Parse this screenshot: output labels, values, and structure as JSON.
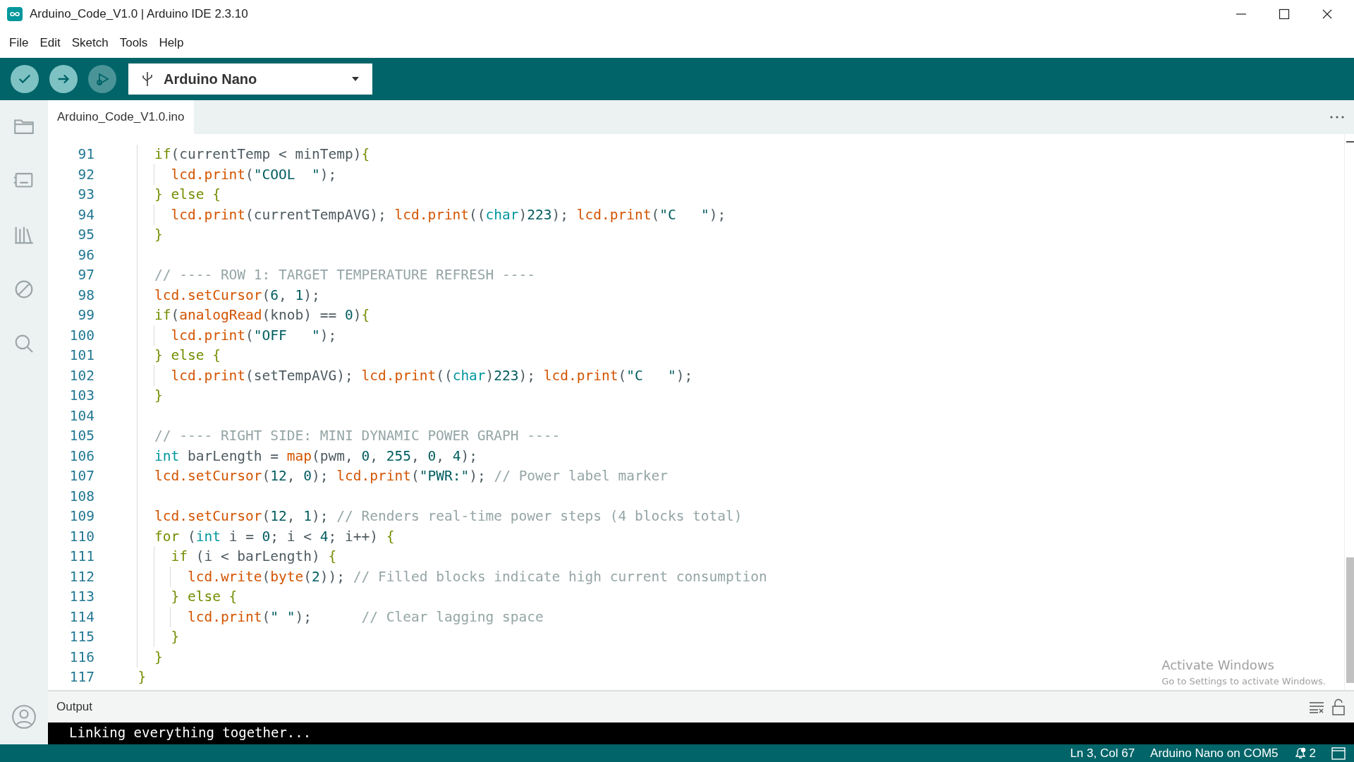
{
  "window": {
    "title": "Arduino_Code_V1.0 | Arduino IDE 2.3.10"
  },
  "menu": [
    "File",
    "Edit",
    "Sketch",
    "Tools",
    "Help"
  ],
  "toolbar": {
    "buttons": [
      {
        "kind": "verify",
        "disabled": false
      },
      {
        "kind": "upload",
        "disabled": false
      },
      {
        "kind": "debug",
        "disabled": true
      }
    ],
    "board": "Arduino Nano"
  },
  "sidebar": [
    {
      "kind": "folder",
      "selected": false
    },
    {
      "kind": "board",
      "selected": false
    },
    {
      "kind": "library",
      "selected": false
    },
    {
      "kind": "debug",
      "selected": false
    },
    {
      "kind": "search",
      "selected": false
    }
  ],
  "tabs": [
    {
      "label": "Arduino_Code_V1.0.ino",
      "selected": true
    }
  ],
  "editor": {
    "lines": [
      {
        "number": "91",
        "tokens": [
          {
            "kind": "kw",
            "text": "    if"
          },
          {
            "kind": "p",
            "text": "(currentTemp < minTemp)"
          },
          {
            "kind": "kw",
            "text": "{"
          }
        ]
      },
      {
        "number": "92",
        "tokens": [
          {
            "kind": "fn",
            "text": "      lcd.print"
          },
          {
            "kind": "p",
            "text": "("
          },
          {
            "kind": "str",
            "text": "\"COOL  \""
          },
          {
            "kind": "p",
            "text": ");"
          }
        ]
      },
      {
        "number": "93",
        "tokens": [
          {
            "kind": "kw",
            "text": "    } else {"
          }
        ]
      },
      {
        "number": "94",
        "tokens": [
          {
            "kind": "fn",
            "text": "      lcd.print"
          },
          {
            "kind": "p",
            "text": "(currentTempAVG); "
          },
          {
            "kind": "fn",
            "text": "lcd.print"
          },
          {
            "kind": "p",
            "text": "(("
          },
          {
            "kind": "type",
            "text": "char"
          },
          {
            "kind": "p",
            "text": ")"
          },
          {
            "kind": "num",
            "text": "223"
          },
          {
            "kind": "p",
            "text": "); "
          },
          {
            "kind": "fn",
            "text": "lcd.print"
          },
          {
            "kind": "p",
            "text": "("
          },
          {
            "kind": "str",
            "text": "\"C   \""
          },
          {
            "kind": "p",
            "text": ");"
          }
        ]
      },
      {
        "number": "95",
        "tokens": [
          {
            "kind": "kw",
            "text": "    }"
          }
        ]
      },
      {
        "number": "96"
      },
      {
        "number": "97",
        "tokens": [
          {
            "kind": "cm",
            "text": "    // ---- ROW 1: TARGET TEMPERATURE REFRESH ----"
          }
        ]
      },
      {
        "number": "98",
        "tokens": [
          {
            "kind": "fn",
            "text": "    lcd.setCursor"
          },
          {
            "kind": "p",
            "text": "("
          },
          {
            "kind": "num",
            "text": "6"
          },
          {
            "kind": "p",
            "text": ", "
          },
          {
            "kind": "num",
            "text": "1"
          },
          {
            "kind": "p",
            "text": ");"
          }
        ]
      },
      {
        "number": "99",
        "tokens": [
          {
            "kind": "kw",
            "text": "    if"
          },
          {
            "kind": "p",
            "text": "("
          },
          {
            "kind": "fn",
            "text": "analogRead"
          },
          {
            "kind": "p",
            "text": "(knob) == "
          },
          {
            "kind": "num",
            "text": "0"
          },
          {
            "kind": "p",
            "text": ")"
          },
          {
            "kind": "kw",
            "text": "{"
          }
        ]
      },
      {
        "number": "100",
        "tokens": [
          {
            "kind": "fn",
            "text": "      lcd.print"
          },
          {
            "kind": "p",
            "text": "("
          },
          {
            "kind": "str",
            "text": "\"OFF   \""
          },
          {
            "kind": "p",
            "text": ");"
          }
        ]
      },
      {
        "number": "101",
        "tokens": [
          {
            "kind": "kw",
            "text": "    } else {"
          }
        ]
      },
      {
        "number": "102",
        "tokens": [
          {
            "kind": "fn",
            "text": "      lcd.print"
          },
          {
            "kind": "p",
            "text": "(setTempAVG); "
          },
          {
            "kind": "fn",
            "text": "lcd.print"
          },
          {
            "kind": "p",
            "text": "(("
          },
          {
            "kind": "type",
            "text": "char"
          },
          {
            "kind": "p",
            "text": ")"
          },
          {
            "kind": "num",
            "text": "223"
          },
          {
            "kind": "p",
            "text": "); "
          },
          {
            "kind": "fn",
            "text": "lcd.print"
          },
          {
            "kind": "p",
            "text": "("
          },
          {
            "kind": "str",
            "text": "\"C   \""
          },
          {
            "kind": "p",
            "text": ");"
          }
        ]
      },
      {
        "number": "103",
        "tokens": [
          {
            "kind": "kw",
            "text": "    }"
          }
        ]
      },
      {
        "number": "104"
      },
      {
        "number": "105",
        "tokens": [
          {
            "kind": "cm",
            "text": "    // ---- RIGHT SIDE: MINI DYNAMIC POWER GRAPH ----"
          }
        ]
      },
      {
        "number": "106",
        "tokens": [
          {
            "kind": "type",
            "text": "    int"
          },
          {
            "kind": "p",
            "text": " barLength = "
          },
          {
            "kind": "fn",
            "text": "map"
          },
          {
            "kind": "p",
            "text": "(pwm, "
          },
          {
            "kind": "num",
            "text": "0"
          },
          {
            "kind": "p",
            "text": ", "
          },
          {
            "kind": "num",
            "text": "255"
          },
          {
            "kind": "p",
            "text": ", "
          },
          {
            "kind": "num",
            "text": "0"
          },
          {
            "kind": "p",
            "text": ", "
          },
          {
            "kind": "num",
            "text": "4"
          },
          {
            "kind": "p",
            "text": ");"
          }
        ]
      },
      {
        "number": "107",
        "tokens": [
          {
            "kind": "fn",
            "text": "    lcd.setCursor"
          },
          {
            "kind": "p",
            "text": "("
          },
          {
            "kind": "num",
            "text": "12"
          },
          {
            "kind": "p",
            "text": ", "
          },
          {
            "kind": "num",
            "text": "0"
          },
          {
            "kind": "p",
            "text": "); "
          },
          {
            "kind": "fn",
            "text": "lcd.print"
          },
          {
            "kind": "p",
            "text": "("
          },
          {
            "kind": "str",
            "text": "\"PWR:\""
          },
          {
            "kind": "p",
            "text": "); "
          },
          {
            "kind": "cm",
            "text": "// Power label marker"
          }
        ]
      },
      {
        "number": "108"
      },
      {
        "number": "109",
        "tokens": [
          {
            "kind": "fn",
            "text": "    lcd.setCursor"
          },
          {
            "kind": "p",
            "text": "("
          },
          {
            "kind": "num",
            "text": "12"
          },
          {
            "kind": "p",
            "text": ", "
          },
          {
            "kind": "num",
            "text": "1"
          },
          {
            "kind": "p",
            "text": "); "
          },
          {
            "kind": "cm",
            "text": "// Renders real-time power steps (4 blocks total)"
          }
        ]
      },
      {
        "number": "110",
        "tokens": [
          {
            "kind": "kw",
            "text": "    for"
          },
          {
            "kind": "p",
            "text": " ("
          },
          {
            "kind": "type",
            "text": "int"
          },
          {
            "kind": "p",
            "text": " i = "
          },
          {
            "kind": "num",
            "text": "0"
          },
          {
            "kind": "p",
            "text": "; i < "
          },
          {
            "kind": "num",
            "text": "4"
          },
          {
            "kind": "p",
            "text": "; i++) "
          },
          {
            "kind": "kw",
            "text": "{"
          }
        ]
      },
      {
        "number": "111",
        "tokens": [
          {
            "kind": "kw",
            "text": "      if"
          },
          {
            "kind": "p",
            "text": " (i < barLength) "
          },
          {
            "kind": "kw",
            "text": "{"
          }
        ]
      },
      {
        "number": "112",
        "tokens": [
          {
            "kind": "fn",
            "text": "        lcd.write"
          },
          {
            "kind": "p",
            "text": "("
          },
          {
            "kind": "fn",
            "text": "byte"
          },
          {
            "kind": "p",
            "text": "("
          },
          {
            "kind": "num",
            "text": "2"
          },
          {
            "kind": "p",
            "text": ")); "
          },
          {
            "kind": "cm",
            "text": "// Filled blocks indicate high current consumption"
          }
        ]
      },
      {
        "number": "113",
        "tokens": [
          {
            "kind": "kw",
            "text": "      } else {"
          }
        ]
      },
      {
        "number": "114",
        "tokens": [
          {
            "kind": "fn",
            "text": "        lcd.print"
          },
          {
            "kind": "p",
            "text": "("
          },
          {
            "kind": "str",
            "text": "\" \""
          },
          {
            "kind": "p",
            "text": ");      "
          },
          {
            "kind": "cm",
            "text": "// Clear lagging space"
          }
        ]
      },
      {
        "number": "115",
        "tokens": [
          {
            "kind": "kw",
            "text": "      }"
          }
        ]
      },
      {
        "number": "116",
        "tokens": [
          {
            "kind": "kw",
            "text": "    }"
          }
        ]
      },
      {
        "number": "117",
        "tokens": [
          {
            "kind": "kw",
            "text": "  }"
          }
        ]
      }
    ]
  },
  "output": {
    "title": "Output",
    "lines": [
      "Linking everything together..."
    ]
  },
  "watermark": {
    "title": "Activate Windows",
    "subtitle": "Go to Settings to activate Windows."
  },
  "status_bar": {
    "position": "Ln 3, Col 67",
    "board": "Arduino Nano on COM5",
    "notifications": "2"
  }
}
